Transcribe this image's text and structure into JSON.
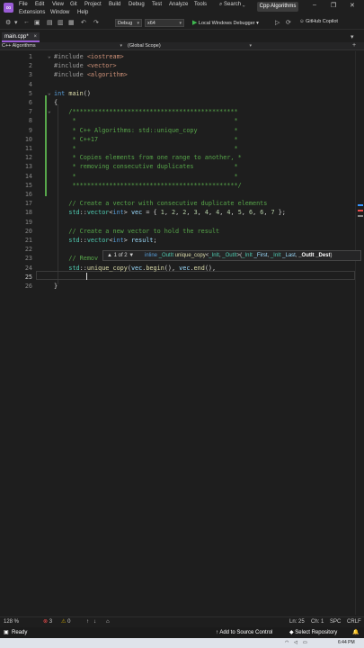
{
  "menu": [
    "File",
    "Edit",
    "View",
    "Git",
    "Project",
    "Build",
    "Debug",
    "Test",
    "Analyze",
    "Tools",
    "Extensions",
    "Window",
    "Help"
  ],
  "search_label": "Search",
  "window_title": "Cpp Algorithms",
  "window_buttons": [
    "–",
    "❐",
    "✕"
  ],
  "toolbar": {
    "config": "Debug",
    "platform": "x64",
    "run_label": "Local Windows Debugger",
    "copilot_label": "GitHub Copilot"
  },
  "tab": {
    "label": "main.cpp*",
    "close": "×"
  },
  "nav": {
    "project": "C++ Algorithms",
    "scope": "(Global Scope)"
  },
  "lines": [
    {
      "n": "1",
      "segs": [
        [
          "inc",
          "#include "
        ],
        [
          "hdr",
          "<iostream>"
        ]
      ]
    },
    {
      "n": "2",
      "segs": [
        [
          "inc",
          "#include "
        ],
        [
          "hdr",
          "<vector>"
        ]
      ]
    },
    {
      "n": "3",
      "segs": [
        [
          "inc",
          "#include "
        ],
        [
          "hdr",
          "<algorithm>"
        ]
      ]
    },
    {
      "n": "4",
      "segs": []
    },
    {
      "n": "5",
      "segs": [
        [
          "kw",
          "int "
        ],
        [
          "fn",
          "main"
        ],
        [
          "",
          "()"
        ]
      ]
    },
    {
      "n": "6",
      "segs": [
        [
          "",
          "{"
        ]
      ]
    },
    {
      "n": "7",
      "segs": [
        [
          "cm",
          "    /*********************************************"
        ]
      ]
    },
    {
      "n": "8",
      "segs": [
        [
          "cm",
          "     *                                           *"
        ]
      ]
    },
    {
      "n": "9",
      "segs": [
        [
          "cm",
          "     * C++ Algorithms: std::unique_copy          *"
        ]
      ]
    },
    {
      "n": "10",
      "segs": [
        [
          "cm",
          "     * C++17                                     *"
        ]
      ]
    },
    {
      "n": "11",
      "segs": [
        [
          "cm",
          "     *                                           *"
        ]
      ]
    },
    {
      "n": "12",
      "segs": [
        [
          "cm",
          "     * Copies elements from one range to another, *"
        ]
      ]
    },
    {
      "n": "13",
      "segs": [
        [
          "cm",
          "     * removing consecutive duplicates           *"
        ]
      ]
    },
    {
      "n": "14",
      "segs": [
        [
          "cm",
          "     *                                           *"
        ]
      ]
    },
    {
      "n": "15",
      "segs": [
        [
          "cm",
          "     *********************************************/"
        ]
      ]
    },
    {
      "n": "16",
      "segs": []
    },
    {
      "n": "17",
      "segs": [
        [
          "cm",
          "    // Create a vector with consecutive duplicate elements"
        ]
      ]
    },
    {
      "n": "18",
      "segs": [
        [
          "ty",
          "    std"
        ],
        [
          "",
          "::"
        ],
        [
          "ty",
          "vector"
        ],
        [
          "",
          "<"
        ],
        [
          "kw",
          "int"
        ],
        [
          "",
          "> "
        ],
        [
          "var",
          "vec"
        ],
        [
          "",
          " = { "
        ],
        [
          "num",
          "1"
        ],
        [
          "",
          ", "
        ],
        [
          "num",
          "2"
        ],
        [
          "",
          ", "
        ],
        [
          "num",
          "2"
        ],
        [
          "",
          ", "
        ],
        [
          "num",
          "3"
        ],
        [
          "",
          ", "
        ],
        [
          "num",
          "4"
        ],
        [
          "",
          ", "
        ],
        [
          "num",
          "4"
        ],
        [
          "",
          ", "
        ],
        [
          "num",
          "4"
        ],
        [
          "",
          ", "
        ],
        [
          "num",
          "5"
        ],
        [
          "",
          ", "
        ],
        [
          "num",
          "6"
        ],
        [
          "",
          ", "
        ],
        [
          "num",
          "6"
        ],
        [
          "",
          ", "
        ],
        [
          "num",
          "7"
        ],
        [
          "",
          " };"
        ]
      ]
    },
    {
      "n": "19",
      "segs": []
    },
    {
      "n": "20",
      "segs": [
        [
          "cm",
          "    // Create a new vector to hold the result"
        ]
      ]
    },
    {
      "n": "21",
      "segs": [
        [
          "ty",
          "    std"
        ],
        [
          "",
          "::"
        ],
        [
          "ty",
          "vector"
        ],
        [
          "",
          "<"
        ],
        [
          "kw",
          "int"
        ],
        [
          "",
          "> "
        ],
        [
          "var",
          "result"
        ],
        [
          "",
          ";"
        ]
      ]
    },
    {
      "n": "22",
      "segs": []
    },
    {
      "n": "23",
      "segs": [
        [
          "cm",
          "    // Remov"
        ]
      ]
    },
    {
      "n": "24",
      "segs": [
        [
          "ty",
          "    std"
        ],
        [
          "",
          "::"
        ],
        [
          "fn",
          "unique_copy"
        ],
        [
          "",
          "("
        ],
        [
          "var",
          "vec"
        ],
        [
          "",
          "."
        ],
        [
          "fn",
          "begin"
        ],
        [
          "",
          "(), "
        ],
        [
          "var",
          "vec"
        ],
        [
          "",
          "."
        ],
        [
          "fn",
          "end"
        ],
        [
          "",
          "(),"
        ]
      ]
    },
    {
      "n": "25",
      "segs": []
    },
    {
      "n": "26",
      "segs": [
        [
          "",
          "}"
        ]
      ]
    }
  ],
  "signature_help": {
    "nav": "▲ 1 of 2 ▼",
    "parts": [
      [
        "k",
        "inline "
      ],
      [
        "t",
        "_OutIt "
      ],
      [
        "f",
        "unique_copy"
      ],
      [
        "",
        "<"
      ],
      [
        "t",
        "_InIt"
      ],
      [
        "",
        ", "
      ],
      [
        "t",
        "_OutIt"
      ],
      [
        "",
        ">("
      ],
      [
        "t",
        "_InIt "
      ],
      [
        "p",
        "_First"
      ],
      [
        "",
        ", "
      ],
      [
        "t",
        "_InIt "
      ],
      [
        "p",
        "_Last"
      ],
      [
        "",
        ", "
      ],
      [
        "b",
        "_OutIt _Dest"
      ],
      [
        "",
        ")"
      ]
    ]
  },
  "editor_status": {
    "zoom": "128 %",
    "errors": "3",
    "warnings": "0",
    "position": "Ln: 25",
    "column": "Ch: 1",
    "spacing": "SPC",
    "eol": "CRLF"
  },
  "statusbar": {
    "ready": "Ready",
    "source_control": "Add to Source Control",
    "repo": "Select Repository"
  },
  "taskbar": {
    "time": "6:44 PM"
  },
  "colors": {
    "accent": "#9a5cd6",
    "comment": "#57a64a",
    "keyword": "#569cd6",
    "type": "#4ec9b0",
    "function": "#dcdcaa",
    "string": "#ce9178"
  }
}
